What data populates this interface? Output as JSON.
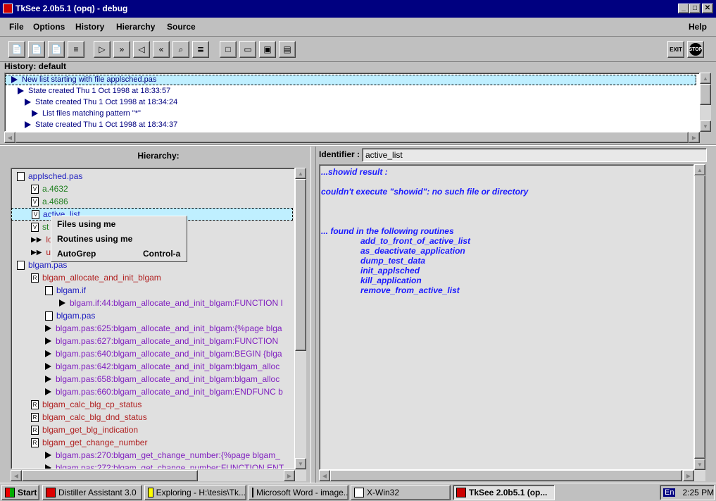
{
  "window": {
    "title": "TkSee 2.0b5.1 (opq) - debug"
  },
  "menu": {
    "file": "File",
    "options": "Options",
    "history": "History",
    "hierarchy": "Hierarchy",
    "source": "Source",
    "help": "Help"
  },
  "toolbar": {
    "buttons": [
      "open-file",
      "open-routine",
      "open-var",
      "filter",
      "forward",
      "forward-fast",
      "back",
      "back-fast",
      "find",
      "grep",
      "new",
      "open-folder",
      "save",
      "notes"
    ],
    "exit_label": "EXIT",
    "stop_label": "STOP"
  },
  "history": {
    "label": "History: default",
    "items": [
      "New list starting with file applsched.pas",
      "State created Thu 1 Oct 1998 at 18:33:57",
      "State created Thu 1 Oct 1998 at 18:34:24",
      "List files matching pattern \"*\"",
      "State created Thu 1 Oct 1998 at 18:34:37"
    ]
  },
  "hierarchy": {
    "label": "Hierarchy:",
    "rows": [
      {
        "icon": "file",
        "text": "applsched.pas",
        "color": "#2020c0"
      },
      {
        "icon": "V",
        "text": "a.4632",
        "color": "#208020"
      },
      {
        "icon": "V",
        "text": "a.4686",
        "color": "#208020"
      },
      {
        "icon": "V",
        "text": "active_list",
        "color": "#2020c0"
      },
      {
        "icon": "V",
        "text": "st",
        "color": "#208020"
      },
      {
        "icon": "dbl",
        "text": "lo",
        "color": "#b02020"
      },
      {
        "icon": "dbl",
        "text": "u",
        "color": "#b02020"
      },
      {
        "icon": "file",
        "text": "blgam.pas",
        "color": "#2020c0"
      },
      {
        "icon": "R",
        "text": "blgam_allocate_and_init_blgam",
        "color": "#b02020"
      },
      {
        "icon": "file",
        "text": "blgam.if",
        "color": "#2020c0"
      },
      {
        "icon": "tri",
        "text": "blgam.if:44:blgam_allocate_and_init_blgam:FUNCTION I",
        "color": "#8020c0"
      },
      {
        "icon": "file",
        "text": "blgam.pas",
        "color": "#2020c0"
      },
      {
        "icon": "tri",
        "text": "blgam.pas:625:blgam_allocate_and_init_blgam:{%page blga",
        "color": "#8020c0"
      },
      {
        "icon": "tri",
        "text": "blgam.pas:627:blgam_allocate_and_init_blgam:FUNCTION",
        "color": "#8020c0"
      },
      {
        "icon": "tri",
        "text": "blgam.pas:640:blgam_allocate_and_init_blgam:BEGIN {blga",
        "color": "#8020c0"
      },
      {
        "icon": "tri",
        "text": "blgam.pas:642:blgam_allocate_and_init_blgam:blgam_alloc",
        "color": "#8020c0"
      },
      {
        "icon": "tri",
        "text": "blgam.pas:658:blgam_allocate_and_init_blgam:blgam_alloc",
        "color": "#8020c0"
      },
      {
        "icon": "tri",
        "text": "blgam.pas:660:blgam_allocate_and_init_blgam:ENDFUNC b",
        "color": "#8020c0"
      },
      {
        "icon": "R",
        "text": "blgam_calc_blg_cp_status",
        "color": "#b02020"
      },
      {
        "icon": "R",
        "text": "blgam_calc_blg_dnd_status",
        "color": "#b02020"
      },
      {
        "icon": "R",
        "text": "blgam_get_blg_indication",
        "color": "#b02020"
      },
      {
        "icon": "R",
        "text": "blgam_get_change_number",
        "color": "#b02020"
      },
      {
        "icon": "tri",
        "text": "blgam.pas:270:blgam_get_change_number:{%page blgam_",
        "color": "#8020c0"
      },
      {
        "icon": "tri",
        "text": "blgam.pas:272:blgam_get_change_number:FUNCTION ENT",
        "color": "#8020c0"
      }
    ]
  },
  "context_menu": {
    "files_using_me": "Files using me",
    "routines_using_me": "Routines using me",
    "autogrep": "AutoGrep",
    "autogrep_shortcut": "Control-a"
  },
  "identifier": {
    "label": "Identifier :",
    "value": "active_list"
  },
  "result": {
    "lines": [
      "...showid result :",
      "couldn't execute \"showid\": no such file or directory",
      "... found in the following routines"
    ],
    "routines": [
      "add_to_front_of_active_list",
      "as_deactivate_application",
      "dump_test_data",
      "init_applsched",
      "kill_application",
      "remove_from_active_list"
    ]
  },
  "taskbar": {
    "start": "Start",
    "tasks": [
      "Distiller Assistant 3.0",
      "Exploring - H:\\tesis\\Tk...",
      "Microsoft Word - image...",
      "X-Win32",
      "TkSee 2.0b5.1 (op..."
    ],
    "lang": "En",
    "clock": "2:25 PM"
  }
}
